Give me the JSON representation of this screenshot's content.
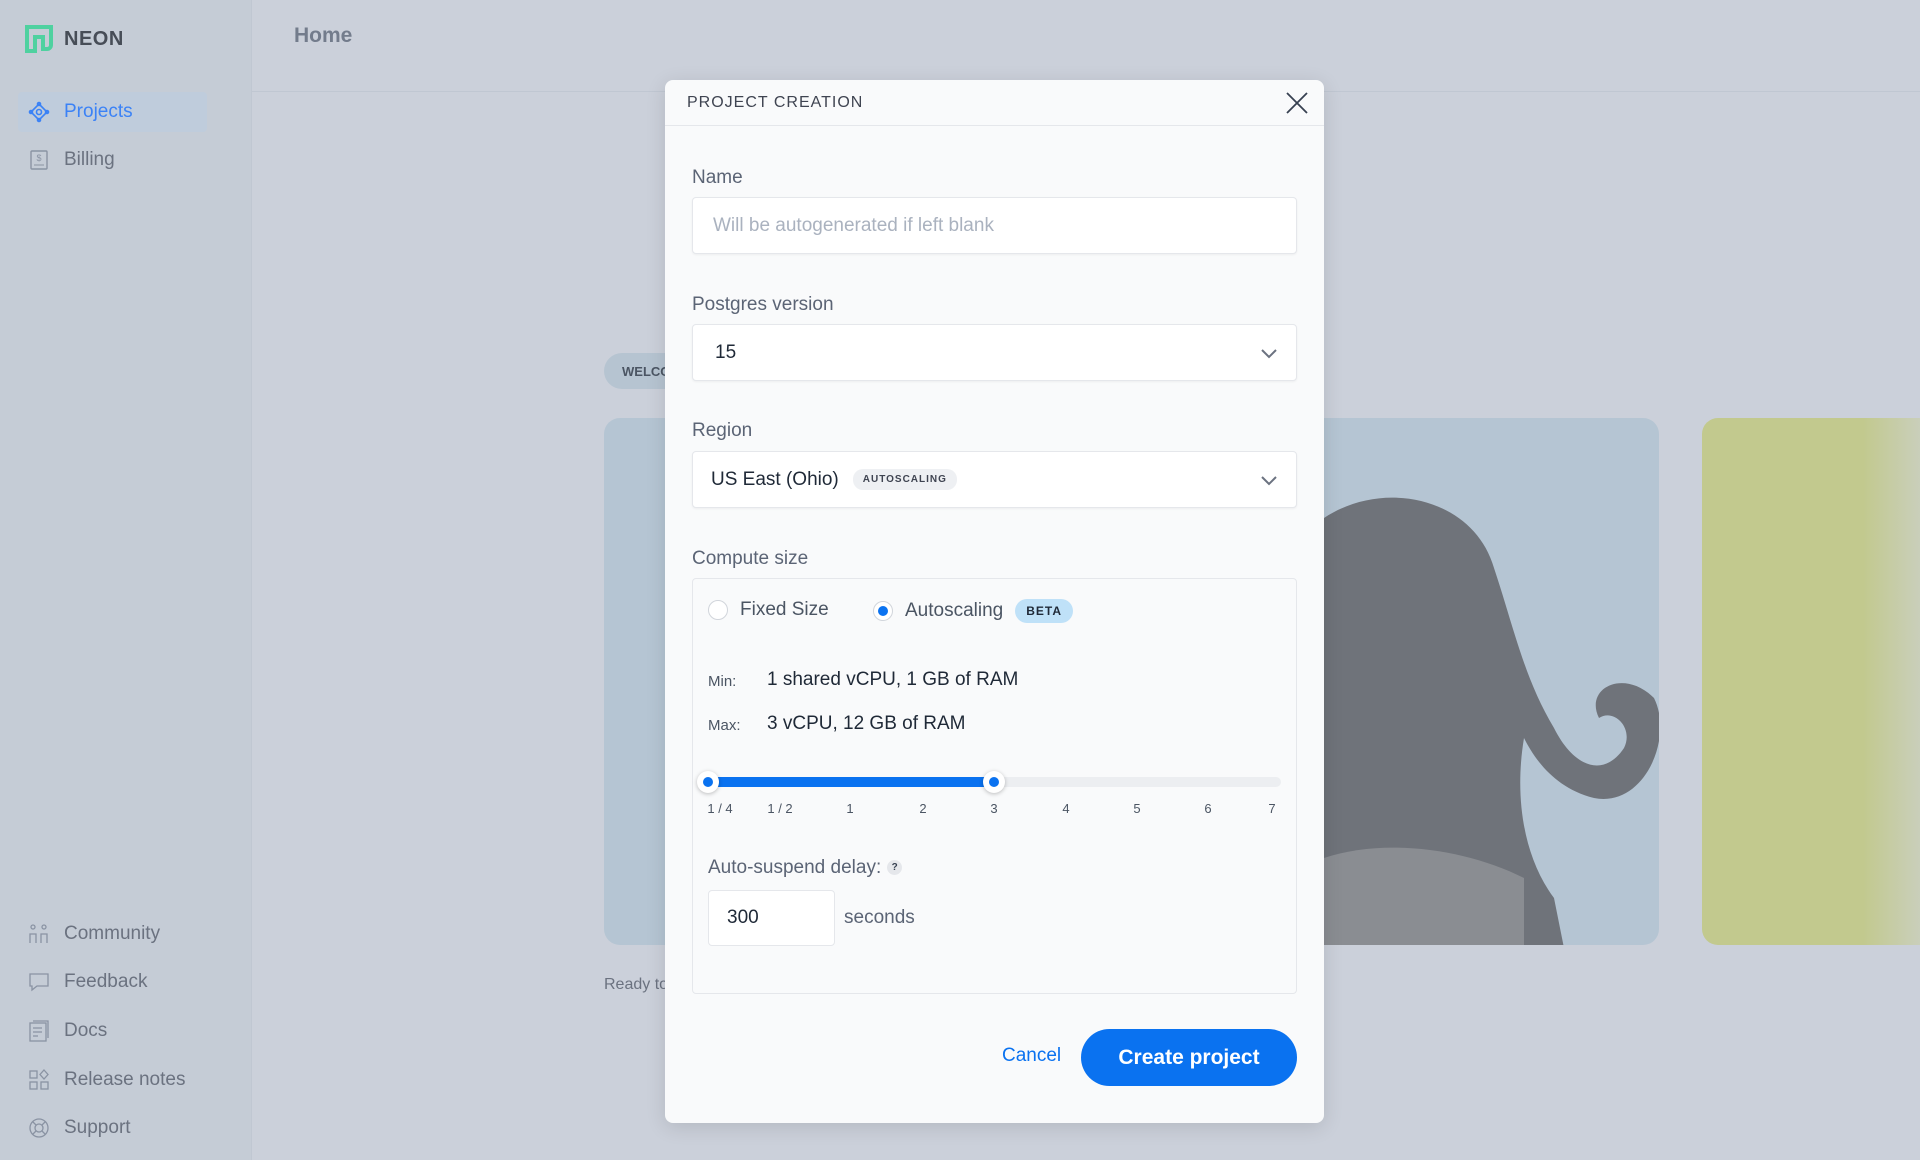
{
  "brand": {
    "name": "NEON",
    "accent": "#0a72f0"
  },
  "sidebar": {
    "top": [
      {
        "label": "Projects",
        "icon": "projects-icon",
        "active": true
      },
      {
        "label": "Billing",
        "icon": "billing-icon"
      }
    ],
    "bottom": [
      {
        "label": "Community",
        "icon": "community-icon"
      },
      {
        "label": "Feedback",
        "icon": "feedback-icon"
      },
      {
        "label": "Docs",
        "icon": "docs-icon"
      },
      {
        "label": "Release notes",
        "icon": "release-notes-icon"
      },
      {
        "label": "Support",
        "icon": "support-icon"
      }
    ]
  },
  "header": {
    "title": "Home"
  },
  "background": {
    "welcome_pill": "WELCOME",
    "footer_text": "Ready to"
  },
  "modal": {
    "title": "PROJECT CREATION",
    "name": {
      "label": "Name",
      "value": "",
      "placeholder": "Will be autogenerated if left blank"
    },
    "postgres": {
      "label": "Postgres version",
      "value": "15"
    },
    "region": {
      "label": "Region",
      "value": "US East (Ohio)",
      "badge": "AUTOSCALING"
    },
    "compute": {
      "label": "Compute size",
      "options": [
        {
          "label": "Fixed Size",
          "selected": false
        },
        {
          "label": "Autoscaling",
          "selected": true,
          "badge": "BETA"
        }
      ],
      "min_label": "Min:",
      "min_value": "1 shared vCPU, 1 GB of RAM",
      "max_label": "Max:",
      "max_value": "3 vCPU, 12 GB of RAM",
      "slider": {
        "ticks": [
          "1 / 4",
          "1 / 2",
          "1",
          "2",
          "3",
          "4",
          "5",
          "6",
          "7"
        ],
        "min": "1 / 4",
        "max": "3"
      }
    },
    "autosuspend": {
      "label": "Auto-suspend delay:",
      "help": "?",
      "value": "300",
      "unit": "seconds"
    },
    "cancel": "Cancel",
    "create": "Create project"
  }
}
